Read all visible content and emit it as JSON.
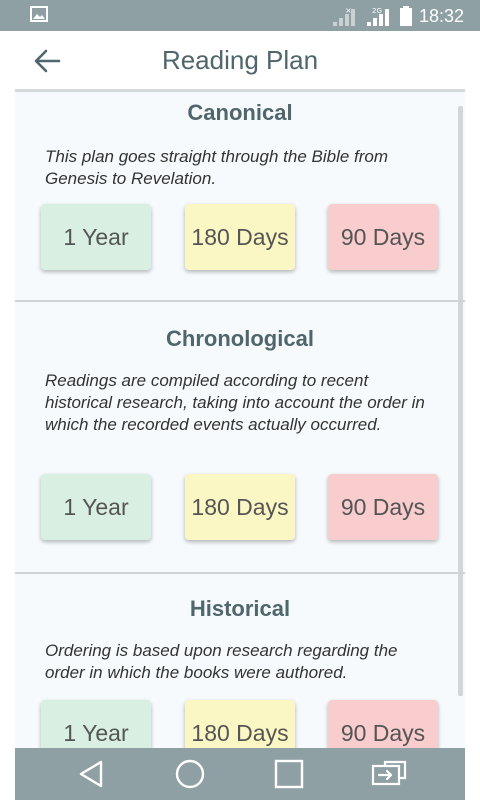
{
  "status_bar": {
    "time": "18:32"
  },
  "app_bar": {
    "title": "Reading Plan"
  },
  "colors": {
    "one_year": "#d9efe1",
    "one_eighty_days": "#fbf7c5",
    "ninety_days": "#f9cdcd",
    "title_text": "#4f666c",
    "nav_background": "#8fa0a5"
  },
  "plans": [
    {
      "title": "Canonical",
      "description": "This plan goes straight through the Bible from Genesis to Revelation.",
      "options": [
        "1 Year",
        "180 Days",
        "90 Days"
      ]
    },
    {
      "title": "Chronological",
      "description": "Readings are compiled according to recent historical research, taking into account the order in which the recorded events actually occurred.",
      "options": [
        "1 Year",
        "180 Days",
        "90 Days"
      ]
    },
    {
      "title": "Historical",
      "description": "Ordering is based upon research regarding the order in which the books were authored.",
      "options": [
        "1 Year",
        "180 Days",
        "90 Days"
      ]
    }
  ],
  "nav_bar": {
    "icons": [
      "back-triangle-icon",
      "home-circle-icon",
      "recents-square-icon",
      "switch-screen-icon"
    ]
  }
}
